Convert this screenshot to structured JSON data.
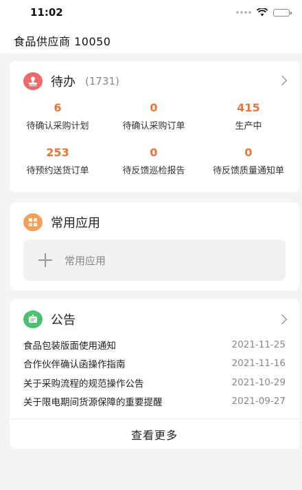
{
  "status_bar": {
    "time": "11:02"
  },
  "header": {
    "title": "食品供应商   10050"
  },
  "todo": {
    "title": "待办",
    "count": "(1731)",
    "stats": [
      {
        "value": "6",
        "label": "待确认采购计划"
      },
      {
        "value": "0",
        "label": "待确认采购订单"
      },
      {
        "value": "415",
        "label": "生产中"
      },
      {
        "value": "253",
        "label": "待预约送货订单"
      },
      {
        "value": "0",
        "label": "待反馈巡检报告"
      },
      {
        "value": "0",
        "label": "待反馈质量通知单"
      }
    ]
  },
  "apps": {
    "title": "常用应用",
    "slot_label": "常用应用"
  },
  "notice": {
    "title": "公告",
    "items": [
      {
        "title": "食品包装版面使用通知",
        "date": "2021-11-25"
      },
      {
        "title": "合作伙伴确认函操作指南",
        "date": "2021-11-16"
      },
      {
        "title": "关于采购流程的规范操作公告",
        "date": "2021-10-29"
      },
      {
        "title": "关于限电期间货源保障的重要提醒",
        "date": "2021-09-27"
      }
    ],
    "more_label": "查看更多"
  },
  "colors": {
    "accent_number": "#e8743b",
    "todo_icon": "#ef6b6b",
    "apps_icon": "#f3a05b",
    "notice_icon": "#4fbf73"
  },
  "icons": {
    "todo": "stamp-icon",
    "apps": "grid-icon",
    "notice": "notice-board-icon"
  }
}
